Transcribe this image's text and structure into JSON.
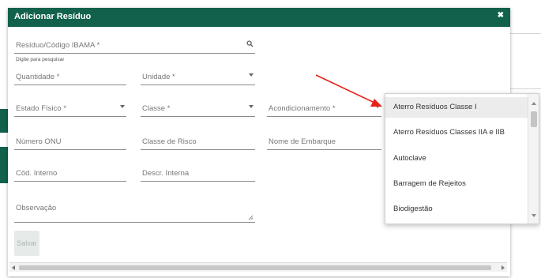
{
  "modal": {
    "title": "Adicionar Resíduo",
    "close_icon": "close-icon",
    "color": "#11614c"
  },
  "fields": {
    "residuo": "Resíduo/Código IBAMA *",
    "residuo_hint": "Digite para pesquisar",
    "quantidade": "Quantidade *",
    "unidade": "Unidade *",
    "estado_fisico": "Estado Físico *",
    "classe": "Classe *",
    "acondicionamento": "Acondicionamento *",
    "numero_onu": "Número ONU",
    "classe_risco": "Classe de Risco",
    "nome_embarque": "Nome de Embarque",
    "cod_interno": "Cód. Interno",
    "descr_interna": "Descr. Interna",
    "observacao": "Observação"
  },
  "save_label": "Salvar",
  "dropdown": {
    "options": [
      "Aterro Resíduos Classe I",
      "Aterro Resíduos Classes IIA e IIB",
      "Autoclave",
      "Barragem de Rejeitos",
      "Biodigestão"
    ],
    "highlighted_index": 0
  },
  "annotation_color": "#e8211b"
}
